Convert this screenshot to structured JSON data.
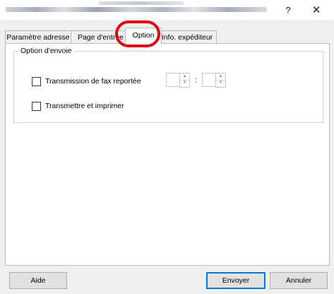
{
  "window": {
    "help_glyph": "?",
    "close_glyph": "✕"
  },
  "tabs": [
    {
      "label": "Paramètre adresse"
    },
    {
      "label": "Page d'entrée"
    },
    {
      "label": "Option"
    },
    {
      "label": "Info. expéditeur"
    }
  ],
  "active_tab": "Option",
  "option_group": {
    "title": "Option d'envoie",
    "delayed_fax": {
      "label": "Transmission de fax reportée",
      "checked": false
    },
    "time_separator": ":",
    "print_after": {
      "label": "Transmettre et imprimer",
      "checked": false
    }
  },
  "spinner": {
    "up_glyph": "▲",
    "down_glyph": "▼"
  },
  "buttons": {
    "help": "Aide",
    "send": "Envoyer",
    "cancel": "Annuler"
  },
  "colors": {
    "highlight": "#e00010",
    "default_button_border": "#0078d7"
  }
}
